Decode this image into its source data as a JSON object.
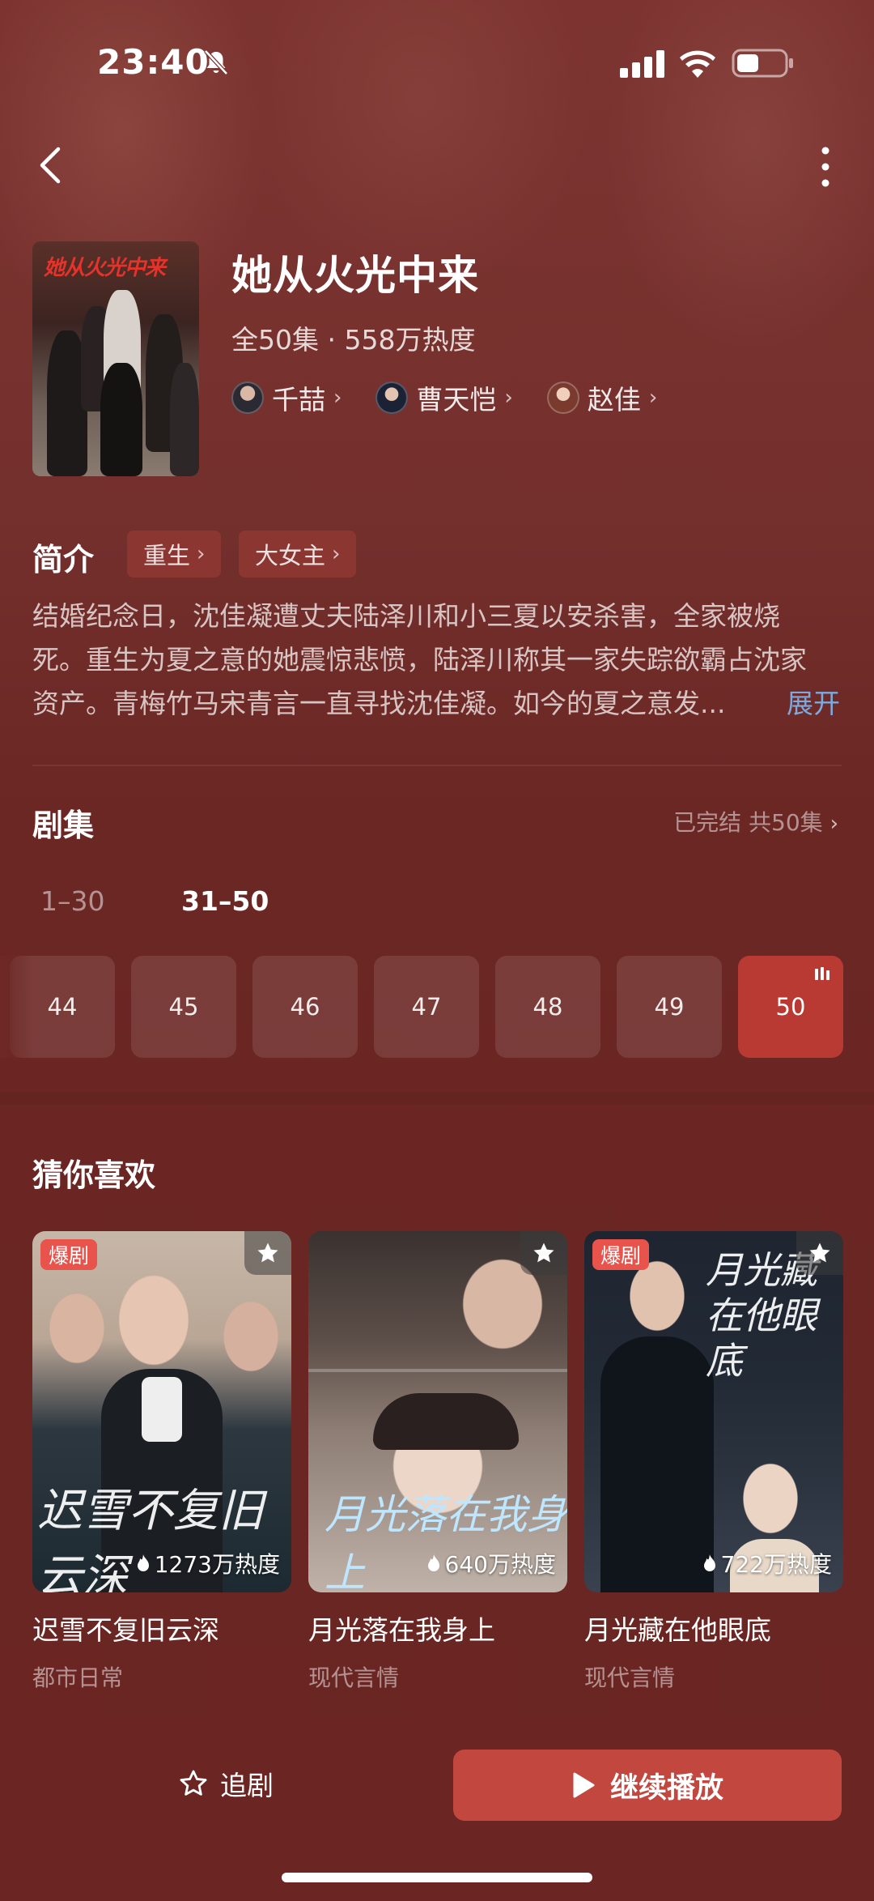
{
  "status_bar": {
    "time": "23:40"
  },
  "show": {
    "title": "她从火光中来",
    "meta": "全50集 · 558万热度",
    "poster_title": "她从火光中来",
    "actors": [
      {
        "name": "千喆"
      },
      {
        "name": "曹天恺"
      },
      {
        "name": "赵佳"
      }
    ]
  },
  "intro": {
    "heading": "简介",
    "tags": [
      "重生",
      "大女主"
    ],
    "synopsis": [
      "结婚纪念日，沈佳凝遭丈夫陆泽川和小三夏以安杀害，全家被烧",
      "死。重生为夏之意的她震惊悲愤，陆泽川称其一家失踪欲霸占沈家",
      "资产。青梅竹马宋青言一直寻找沈佳凝。如今的夏之意发..."
    ],
    "expand_label": "展开"
  },
  "episodes": {
    "heading": "剧集",
    "status": "已完结 共50集",
    "ranges": [
      "1–30",
      "31–50"
    ],
    "active_range": "31–50",
    "items": [
      "44",
      "45",
      "46",
      "47",
      "48",
      "49",
      "50"
    ],
    "current": "50"
  },
  "recommend": {
    "heading": "猜你喜欢",
    "cards": [
      {
        "title": "迟雪不复旧云深",
        "genre": "都市日常",
        "heat": "1273万热度",
        "badge": "爆剧",
        "art_text": "迟雪不复旧云深"
      },
      {
        "title": "月光落在我身上",
        "genre": "现代言情",
        "heat": "640万热度",
        "badge": "",
        "art_text": "月光落在我身上"
      },
      {
        "title": "月光藏在他眼底",
        "genre": "现代言情",
        "heat": "722万热度",
        "badge": "爆剧",
        "art_text": "月光藏在他眼底"
      }
    ]
  },
  "bottom_bar": {
    "follow_label": "追剧",
    "play_label": "继续播放"
  },
  "colors": {
    "background": "#6e2623",
    "accent_button": "#c1473f",
    "current_episode": "#b83a33",
    "tag_bg": "#8c3632",
    "link_blue": "#7fa9dd",
    "hot_badge": "#e8544c"
  }
}
